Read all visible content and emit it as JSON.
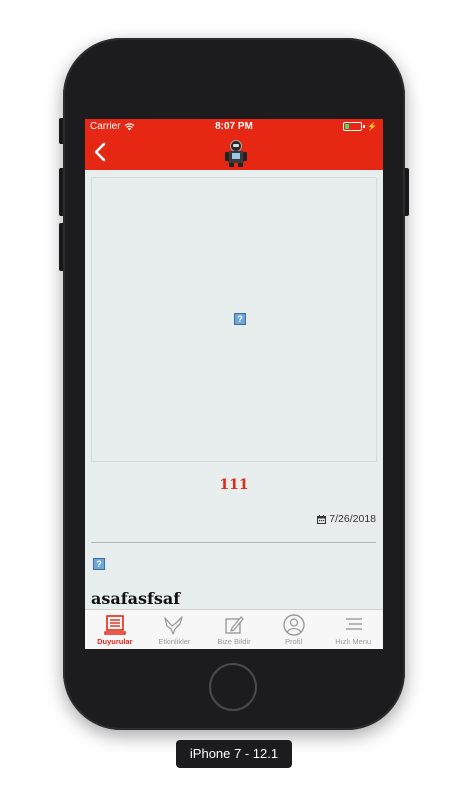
{
  "status_bar": {
    "carrier": "Carrier",
    "time": "8:07 PM",
    "icons": [
      "wifi-icon",
      "battery-icon",
      "charging-bolt-icon"
    ]
  },
  "nav": {
    "back_icon": "chevron-left-icon",
    "logo_icon": "robot-logo-icon"
  },
  "post": {
    "title": "111",
    "date": "7/26/2018",
    "date_icon": "calendar-icon",
    "item_title": "asafasfsaf",
    "broken_image_glyph": "?"
  },
  "tabs": [
    {
      "label": "Duyurular",
      "icon": "newspaper-icon",
      "active": true
    },
    {
      "label": "Etkinlikler",
      "icon": "bird-icon",
      "active": false
    },
    {
      "label": "Bize Bildir",
      "icon": "edit-icon",
      "active": false
    },
    {
      "label": "Profil",
      "icon": "profile-icon",
      "active": false
    },
    {
      "label": "Hızlı Menu",
      "icon": "menu-lines-icon",
      "active": false
    }
  ],
  "caption": "iPhone 7 - 12.1",
  "colors": {
    "brand_red": "#e52713",
    "screen_bg": "#e8edee",
    "tab_inactive": "#9a9a9a"
  }
}
